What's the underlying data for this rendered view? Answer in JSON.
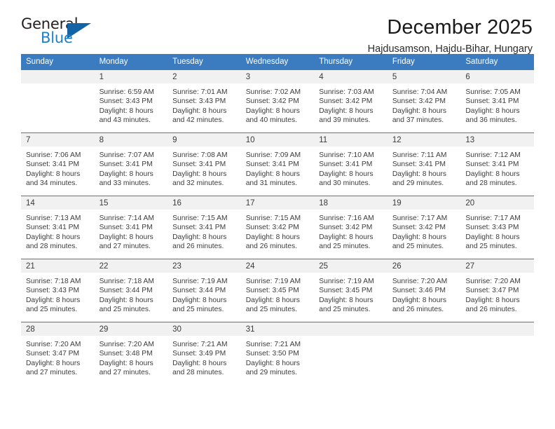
{
  "logo": {
    "word_top": "General",
    "word_bottom": "Blue",
    "triangle_color": "#1464a5",
    "blue_color": "#1f7fc4"
  },
  "header": {
    "title": "December 2025",
    "subtitle": "Hajdusamson, Hajdu-Bihar, Hungary"
  },
  "theme": {
    "header_blue": "#3b7cc0",
    "daynum_band": "#f1f1f1",
    "text": "#3c3c3c"
  },
  "calendar": {
    "weekday_headers": [
      "Sunday",
      "Monday",
      "Tuesday",
      "Wednesday",
      "Thursday",
      "Friday",
      "Saturday"
    ],
    "weeks": [
      [
        {
          "empty": true,
          "day": "",
          "sunrise": "",
          "sunset": "",
          "daylight_line1": "",
          "daylight_line2": ""
        },
        {
          "empty": false,
          "day": "1",
          "sunrise": "Sunrise: 6:59 AM",
          "sunset": "Sunset: 3:43 PM",
          "daylight_line1": "Daylight: 8 hours",
          "daylight_line2": "and 43 minutes."
        },
        {
          "empty": false,
          "day": "2",
          "sunrise": "Sunrise: 7:01 AM",
          "sunset": "Sunset: 3:43 PM",
          "daylight_line1": "Daylight: 8 hours",
          "daylight_line2": "and 42 minutes."
        },
        {
          "empty": false,
          "day": "3",
          "sunrise": "Sunrise: 7:02 AM",
          "sunset": "Sunset: 3:42 PM",
          "daylight_line1": "Daylight: 8 hours",
          "daylight_line2": "and 40 minutes."
        },
        {
          "empty": false,
          "day": "4",
          "sunrise": "Sunrise: 7:03 AM",
          "sunset": "Sunset: 3:42 PM",
          "daylight_line1": "Daylight: 8 hours",
          "daylight_line2": "and 39 minutes."
        },
        {
          "empty": false,
          "day": "5",
          "sunrise": "Sunrise: 7:04 AM",
          "sunset": "Sunset: 3:42 PM",
          "daylight_line1": "Daylight: 8 hours",
          "daylight_line2": "and 37 minutes."
        },
        {
          "empty": false,
          "day": "6",
          "sunrise": "Sunrise: 7:05 AM",
          "sunset": "Sunset: 3:41 PM",
          "daylight_line1": "Daylight: 8 hours",
          "daylight_line2": "and 36 minutes."
        }
      ],
      [
        {
          "empty": false,
          "day": "7",
          "sunrise": "Sunrise: 7:06 AM",
          "sunset": "Sunset: 3:41 PM",
          "daylight_line1": "Daylight: 8 hours",
          "daylight_line2": "and 34 minutes."
        },
        {
          "empty": false,
          "day": "8",
          "sunrise": "Sunrise: 7:07 AM",
          "sunset": "Sunset: 3:41 PM",
          "daylight_line1": "Daylight: 8 hours",
          "daylight_line2": "and 33 minutes."
        },
        {
          "empty": false,
          "day": "9",
          "sunrise": "Sunrise: 7:08 AM",
          "sunset": "Sunset: 3:41 PM",
          "daylight_line1": "Daylight: 8 hours",
          "daylight_line2": "and 32 minutes."
        },
        {
          "empty": false,
          "day": "10",
          "sunrise": "Sunrise: 7:09 AM",
          "sunset": "Sunset: 3:41 PM",
          "daylight_line1": "Daylight: 8 hours",
          "daylight_line2": "and 31 minutes."
        },
        {
          "empty": false,
          "day": "11",
          "sunrise": "Sunrise: 7:10 AM",
          "sunset": "Sunset: 3:41 PM",
          "daylight_line1": "Daylight: 8 hours",
          "daylight_line2": "and 30 minutes."
        },
        {
          "empty": false,
          "day": "12",
          "sunrise": "Sunrise: 7:11 AM",
          "sunset": "Sunset: 3:41 PM",
          "daylight_line1": "Daylight: 8 hours",
          "daylight_line2": "and 29 minutes."
        },
        {
          "empty": false,
          "day": "13",
          "sunrise": "Sunrise: 7:12 AM",
          "sunset": "Sunset: 3:41 PM",
          "daylight_line1": "Daylight: 8 hours",
          "daylight_line2": "and 28 minutes."
        }
      ],
      [
        {
          "empty": false,
          "day": "14",
          "sunrise": "Sunrise: 7:13 AM",
          "sunset": "Sunset: 3:41 PM",
          "daylight_line1": "Daylight: 8 hours",
          "daylight_line2": "and 28 minutes."
        },
        {
          "empty": false,
          "day": "15",
          "sunrise": "Sunrise: 7:14 AM",
          "sunset": "Sunset: 3:41 PM",
          "daylight_line1": "Daylight: 8 hours",
          "daylight_line2": "and 27 minutes."
        },
        {
          "empty": false,
          "day": "16",
          "sunrise": "Sunrise: 7:15 AM",
          "sunset": "Sunset: 3:41 PM",
          "daylight_line1": "Daylight: 8 hours",
          "daylight_line2": "and 26 minutes."
        },
        {
          "empty": false,
          "day": "17",
          "sunrise": "Sunrise: 7:15 AM",
          "sunset": "Sunset: 3:42 PM",
          "daylight_line1": "Daylight: 8 hours",
          "daylight_line2": "and 26 minutes."
        },
        {
          "empty": false,
          "day": "18",
          "sunrise": "Sunrise: 7:16 AM",
          "sunset": "Sunset: 3:42 PM",
          "daylight_line1": "Daylight: 8 hours",
          "daylight_line2": "and 25 minutes."
        },
        {
          "empty": false,
          "day": "19",
          "sunrise": "Sunrise: 7:17 AM",
          "sunset": "Sunset: 3:42 PM",
          "daylight_line1": "Daylight: 8 hours",
          "daylight_line2": "and 25 minutes."
        },
        {
          "empty": false,
          "day": "20",
          "sunrise": "Sunrise: 7:17 AM",
          "sunset": "Sunset: 3:43 PM",
          "daylight_line1": "Daylight: 8 hours",
          "daylight_line2": "and 25 minutes."
        }
      ],
      [
        {
          "empty": false,
          "day": "21",
          "sunrise": "Sunrise: 7:18 AM",
          "sunset": "Sunset: 3:43 PM",
          "daylight_line1": "Daylight: 8 hours",
          "daylight_line2": "and 25 minutes."
        },
        {
          "empty": false,
          "day": "22",
          "sunrise": "Sunrise: 7:18 AM",
          "sunset": "Sunset: 3:44 PM",
          "daylight_line1": "Daylight: 8 hours",
          "daylight_line2": "and 25 minutes."
        },
        {
          "empty": false,
          "day": "23",
          "sunrise": "Sunrise: 7:19 AM",
          "sunset": "Sunset: 3:44 PM",
          "daylight_line1": "Daylight: 8 hours",
          "daylight_line2": "and 25 minutes."
        },
        {
          "empty": false,
          "day": "24",
          "sunrise": "Sunrise: 7:19 AM",
          "sunset": "Sunset: 3:45 PM",
          "daylight_line1": "Daylight: 8 hours",
          "daylight_line2": "and 25 minutes."
        },
        {
          "empty": false,
          "day": "25",
          "sunrise": "Sunrise: 7:19 AM",
          "sunset": "Sunset: 3:45 PM",
          "daylight_line1": "Daylight: 8 hours",
          "daylight_line2": "and 25 minutes."
        },
        {
          "empty": false,
          "day": "26",
          "sunrise": "Sunrise: 7:20 AM",
          "sunset": "Sunset: 3:46 PM",
          "daylight_line1": "Daylight: 8 hours",
          "daylight_line2": "and 26 minutes."
        },
        {
          "empty": false,
          "day": "27",
          "sunrise": "Sunrise: 7:20 AM",
          "sunset": "Sunset: 3:47 PM",
          "daylight_line1": "Daylight: 8 hours",
          "daylight_line2": "and 26 minutes."
        }
      ],
      [
        {
          "empty": false,
          "day": "28",
          "sunrise": "Sunrise: 7:20 AM",
          "sunset": "Sunset: 3:47 PM",
          "daylight_line1": "Daylight: 8 hours",
          "daylight_line2": "and 27 minutes."
        },
        {
          "empty": false,
          "day": "29",
          "sunrise": "Sunrise: 7:20 AM",
          "sunset": "Sunset: 3:48 PM",
          "daylight_line1": "Daylight: 8 hours",
          "daylight_line2": "and 27 minutes."
        },
        {
          "empty": false,
          "day": "30",
          "sunrise": "Sunrise: 7:21 AM",
          "sunset": "Sunset: 3:49 PM",
          "daylight_line1": "Daylight: 8 hours",
          "daylight_line2": "and 28 minutes."
        },
        {
          "empty": false,
          "day": "31",
          "sunrise": "Sunrise: 7:21 AM",
          "sunset": "Sunset: 3:50 PM",
          "daylight_line1": "Daylight: 8 hours",
          "daylight_line2": "and 29 minutes."
        },
        {
          "empty": true,
          "day": "",
          "sunrise": "",
          "sunset": "",
          "daylight_line1": "",
          "daylight_line2": ""
        },
        {
          "empty": true,
          "day": "",
          "sunrise": "",
          "sunset": "",
          "daylight_line1": "",
          "daylight_line2": ""
        },
        {
          "empty": true,
          "day": "",
          "sunrise": "",
          "sunset": "",
          "daylight_line1": "",
          "daylight_line2": ""
        }
      ]
    ]
  }
}
